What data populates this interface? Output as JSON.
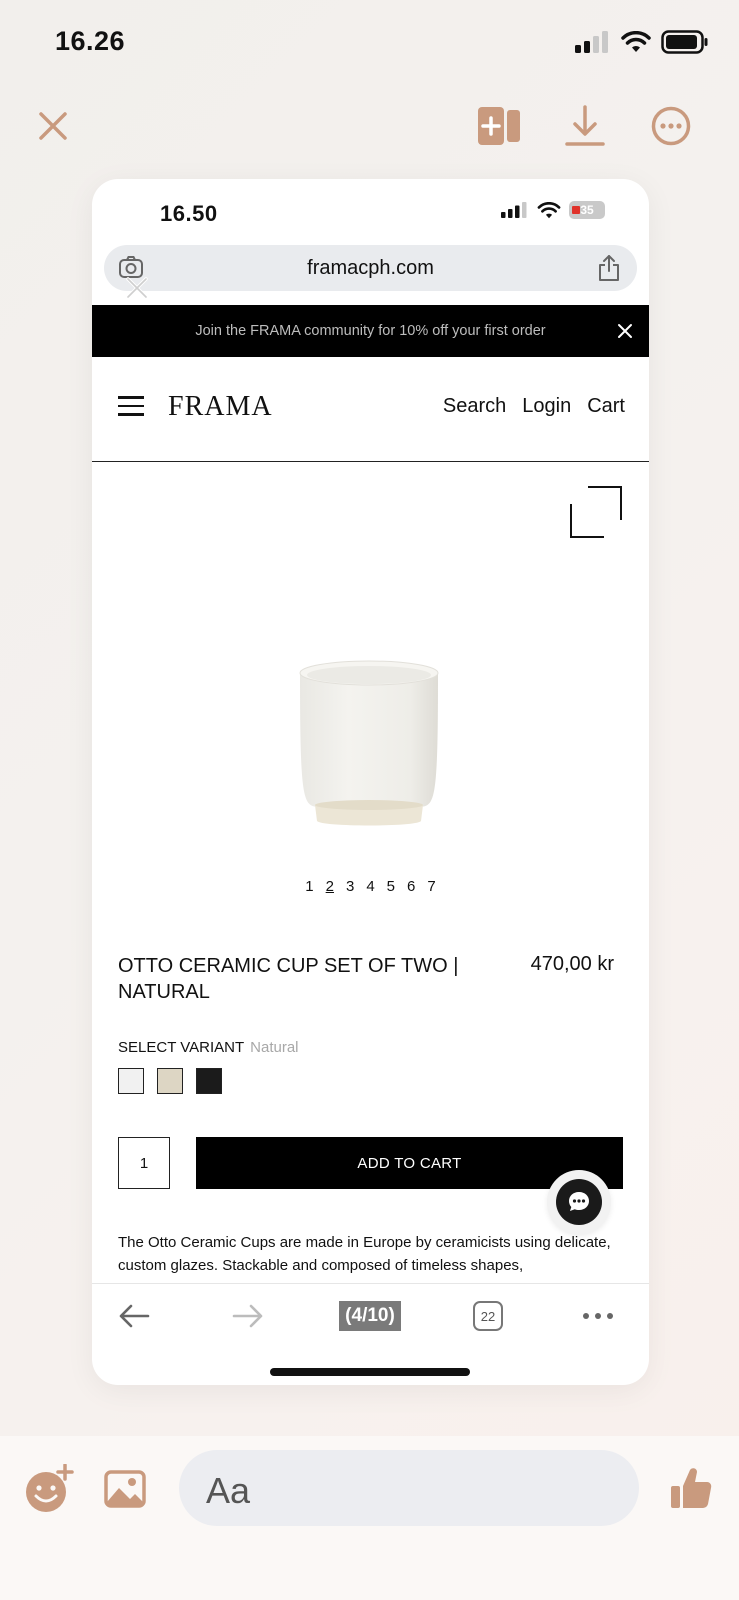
{
  "outer_status": {
    "time": "16.26"
  },
  "viewer_toolbar": {
    "close_icon": "close-icon",
    "add_page_icon": "add-to-page-icon",
    "download_icon": "download-icon",
    "more_icon": "more-icon"
  },
  "screenshot": {
    "status": {
      "time": "16.50",
      "battery": "35"
    },
    "url": "framacph.com",
    "banner": {
      "text": "Join the FRAMA community for 10% off your first order"
    },
    "nav": {
      "logo": "FRAMA",
      "links": [
        "Search",
        "Login",
        "Cart"
      ]
    },
    "gallery": {
      "pages": [
        "1",
        "2",
        "3",
        "4",
        "5",
        "6",
        "7"
      ],
      "current_page": "2"
    },
    "product": {
      "title": "OTTO CERAMIC CUP SET OF TWO | NATURAL",
      "price": "470,00 kr",
      "variant_label": "SELECT VARIANT",
      "variant_value": "Natural",
      "swatches": [
        {
          "name": "White",
          "color": "#f1f1f1"
        },
        {
          "name": "Natural",
          "color": "#ddd6c4"
        },
        {
          "name": "Black",
          "color": "#1b1b1b"
        }
      ],
      "quantity": "1",
      "add_to_cart": "ADD TO CART",
      "description": "The Otto Ceramic Cups are made in Europe by ceramicists using delicate, custom glazes. Stackable and composed of timeless shapes,"
    },
    "browser_bar": {
      "page_count": "(4/10)",
      "tab_count": "22"
    }
  },
  "messenger": {
    "input_placeholder": "Aa"
  },
  "colors": {
    "accent": "#c99a7e",
    "background": "#f3f0ed"
  }
}
